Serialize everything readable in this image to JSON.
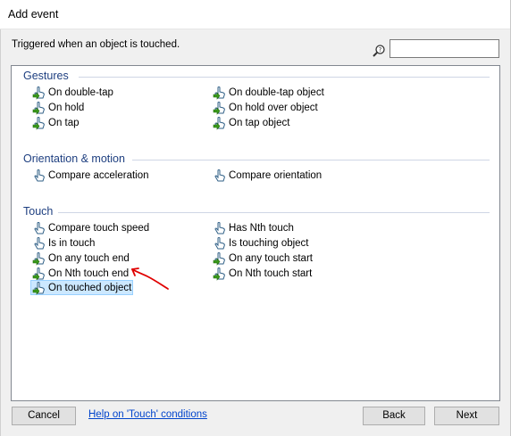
{
  "window": {
    "title": "Add event"
  },
  "description": "Triggered when an object is touched.",
  "search": {
    "value": "",
    "placeholder": ""
  },
  "groups": [
    {
      "name": "Gestures",
      "items": [
        {
          "label": "On double-tap",
          "icon": "trigger-touch-icon"
        },
        {
          "label": "On hold",
          "icon": "trigger-touch-icon"
        },
        {
          "label": "On tap",
          "icon": "trigger-touch-icon"
        },
        {
          "label": "On double-tap object",
          "icon": "trigger-touch-icon"
        },
        {
          "label": "On hold over object",
          "icon": "trigger-touch-icon"
        },
        {
          "label": "On tap object",
          "icon": "trigger-touch-icon"
        }
      ]
    },
    {
      "name": "Orientation & motion",
      "items": [
        {
          "label": "Compare acceleration",
          "icon": "condition-touch-icon"
        },
        {
          "label": "Compare orientation",
          "icon": "condition-touch-icon"
        }
      ]
    },
    {
      "name": "Touch",
      "items": [
        {
          "label": "Compare touch speed",
          "icon": "condition-touch-icon"
        },
        {
          "label": "Is in touch",
          "icon": "condition-touch-icon"
        },
        {
          "label": "On any touch end",
          "icon": "trigger-touch-icon"
        },
        {
          "label": "On Nth touch end",
          "icon": "trigger-touch-icon"
        },
        {
          "label": "On touched object",
          "icon": "trigger-touch-icon",
          "selected": true
        },
        {
          "label": "Has Nth touch",
          "icon": "condition-touch-icon"
        },
        {
          "label": "Is touching object",
          "icon": "condition-touch-icon"
        },
        {
          "label": "On any touch start",
          "icon": "trigger-touch-icon"
        },
        {
          "label": "On Nth touch start",
          "icon": "trigger-touch-icon"
        }
      ]
    }
  ],
  "footer": {
    "cancel": "Cancel",
    "help_link": "Help on 'Touch' conditions",
    "back": "Back",
    "next": "Next"
  },
  "colors": {
    "group_header": "#1e3f80",
    "selection": "#cce8ff",
    "trigger_arrow": "#3a9a1a",
    "annotation": "#e00000"
  }
}
